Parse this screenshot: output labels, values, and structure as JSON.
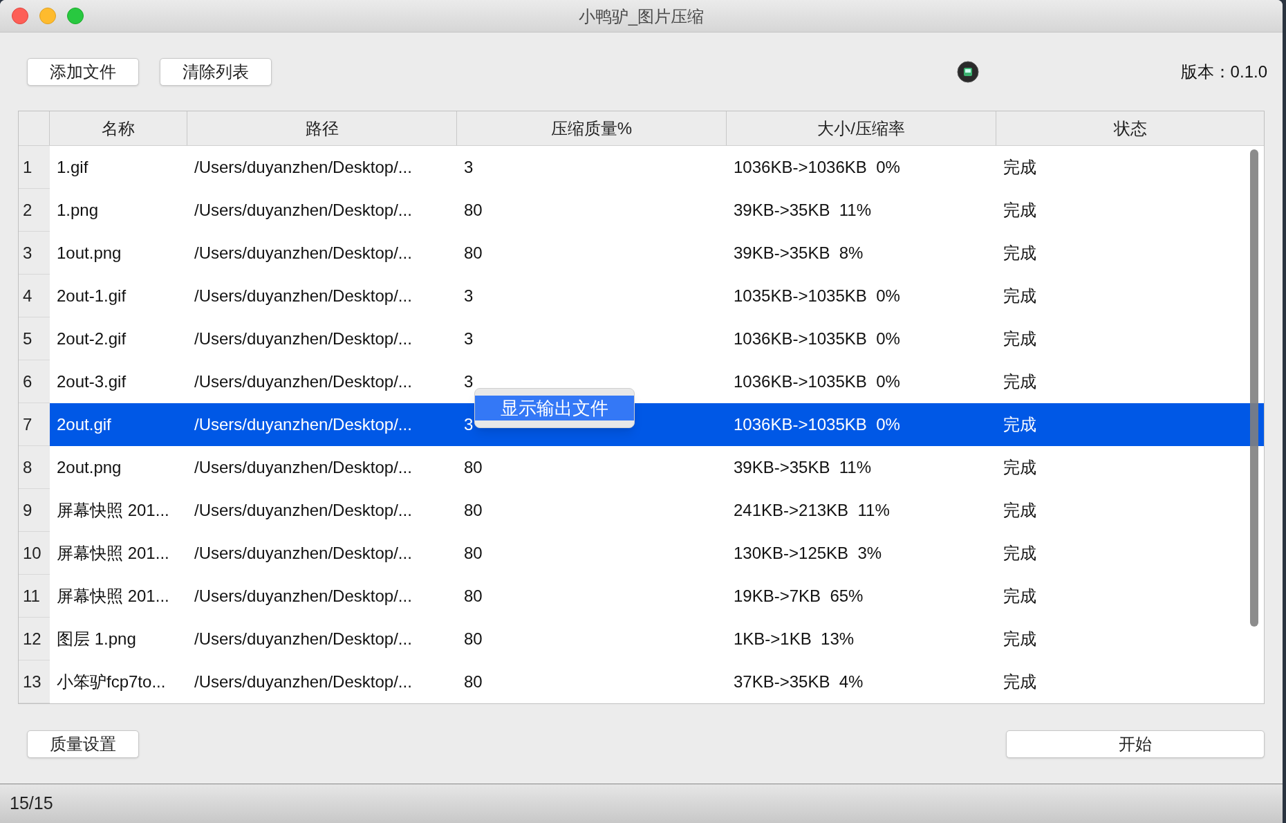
{
  "window": {
    "title": "小鸭驴_图片压缩"
  },
  "toolbar": {
    "buttons": [
      "添加文件",
      "清除列表"
    ],
    "version": "版本：0.1.0"
  },
  "table": {
    "columns": [
      "名称",
      "路径",
      "压缩质量%",
      "大小/压缩率",
      "状态"
    ],
    "rows": [
      {
        "index": "1",
        "name": "1.gif",
        "path": "/Users/duyanzhen/Desktop/...",
        "quality": "3",
        "size": "1036KB->1036KB  0%",
        "status": "完成",
        "selected": false
      },
      {
        "index": "2",
        "name": "1.png",
        "path": "/Users/duyanzhen/Desktop/...",
        "quality": "80",
        "size": "39KB->35KB  11%",
        "status": "完成",
        "selected": false
      },
      {
        "index": "3",
        "name": "1out.png",
        "path": "/Users/duyanzhen/Desktop/...",
        "quality": "80",
        "size": "39KB->35KB  8%",
        "status": "完成",
        "selected": false
      },
      {
        "index": "4",
        "name": "2out-1.gif",
        "path": "/Users/duyanzhen/Desktop/...",
        "quality": "3",
        "size": "1035KB->1035KB  0%",
        "status": "完成",
        "selected": false
      },
      {
        "index": "5",
        "name": "2out-2.gif",
        "path": "/Users/duyanzhen/Desktop/...",
        "quality": "3",
        "size": "1036KB->1035KB  0%",
        "status": "完成",
        "selected": false
      },
      {
        "index": "6",
        "name": "2out-3.gif",
        "path": "/Users/duyanzhen/Desktop/...",
        "quality": "3",
        "size": "1036KB->1035KB  0%",
        "status": "完成",
        "selected": false
      },
      {
        "index": "7",
        "name": "2out.gif",
        "path": "/Users/duyanzhen/Desktop/...",
        "quality": "3",
        "size": "1036KB->1035KB  0%",
        "status": "完成",
        "selected": true
      },
      {
        "index": "8",
        "name": "2out.png",
        "path": "/Users/duyanzhen/Desktop/...",
        "quality": "80",
        "size": "39KB->35KB  11%",
        "status": "完成",
        "selected": false
      },
      {
        "index": "9",
        "name": "屏幕快照 201...",
        "path": "/Users/duyanzhen/Desktop/...",
        "quality": "80",
        "size": "241KB->213KB  11%",
        "status": "完成",
        "selected": false
      },
      {
        "index": "10",
        "name": "屏幕快照 201...",
        "path": "/Users/duyanzhen/Desktop/...",
        "quality": "80",
        "size": "130KB->125KB  3%",
        "status": "完成",
        "selected": false
      },
      {
        "index": "11",
        "name": "屏幕快照 201...",
        "path": "/Users/duyanzhen/Desktop/...",
        "quality": "80",
        "size": "19KB->7KB  65%",
        "status": "完成",
        "selected": false
      },
      {
        "index": "12",
        "name": "图层 1.png",
        "path": "/Users/duyanzhen/Desktop/...",
        "quality": "80",
        "size": "1KB->1KB  13%",
        "status": "完成",
        "selected": false
      },
      {
        "index": "13",
        "name": "小笨驴fcp7to...",
        "path": "/Users/duyanzhen/Desktop/...",
        "quality": "80",
        "size": "37KB->35KB  4%",
        "status": "完成",
        "selected": false
      }
    ]
  },
  "context_menu": {
    "items": [
      {
        "label": "显示输出文件",
        "selected": true
      }
    ]
  },
  "bottom": {
    "left_button": "质量设置",
    "right_button": "开始"
  },
  "status_bar": "15/15"
}
